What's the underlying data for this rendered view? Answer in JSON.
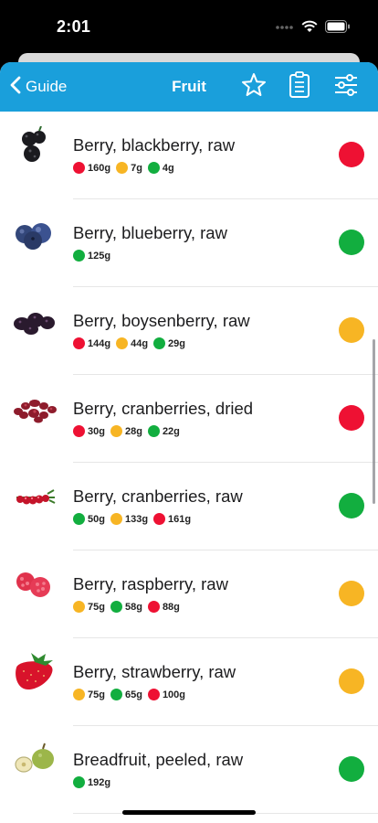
{
  "status_bar": {
    "time": "2:01"
  },
  "nav": {
    "back_label": "Guide",
    "title": "Fruit"
  },
  "colors": {
    "red": "#ee1133",
    "orange": "#f7b524",
    "green": "#12ae3f",
    "nav_blue": "#1a9fdb"
  },
  "foods": [
    {
      "name": "Berry, blackberry, raw",
      "status": "red",
      "icon": "blackberry-icon",
      "chips": [
        {
          "color": "red",
          "value": "160g"
        },
        {
          "color": "orange",
          "value": "7g"
        },
        {
          "color": "green",
          "value": "4g"
        }
      ]
    },
    {
      "name": "Berry, blueberry, raw",
      "status": "green",
      "icon": "blueberry-icon",
      "chips": [
        {
          "color": "green",
          "value": "125g"
        }
      ]
    },
    {
      "name": "Berry, boysenberry, raw",
      "status": "orange",
      "icon": "boysenberry-icon",
      "chips": [
        {
          "color": "red",
          "value": "144g"
        },
        {
          "color": "orange",
          "value": "44g"
        },
        {
          "color": "green",
          "value": "29g"
        }
      ]
    },
    {
      "name": "Berry, cranberries, dried",
      "status": "red",
      "icon": "dried-cranberries-icon",
      "chips": [
        {
          "color": "red",
          "value": "30g"
        },
        {
          "color": "orange",
          "value": "28g"
        },
        {
          "color": "green",
          "value": "22g"
        }
      ]
    },
    {
      "name": "Berry, cranberries, raw",
      "status": "green",
      "icon": "cranberries-icon",
      "chips": [
        {
          "color": "green",
          "value": "50g"
        },
        {
          "color": "orange",
          "value": "133g"
        },
        {
          "color": "red",
          "value": "161g"
        }
      ]
    },
    {
      "name": "Berry, raspberry, raw",
      "status": "orange",
      "icon": "raspberry-icon",
      "chips": [
        {
          "color": "orange",
          "value": "75g"
        },
        {
          "color": "green",
          "value": "58g"
        },
        {
          "color": "red",
          "value": "88g"
        }
      ]
    },
    {
      "name": "Berry, strawberry, raw",
      "status": "orange",
      "icon": "strawberry-icon",
      "chips": [
        {
          "color": "orange",
          "value": "75g"
        },
        {
          "color": "green",
          "value": "65g"
        },
        {
          "color": "red",
          "value": "100g"
        }
      ]
    },
    {
      "name": "Breadfruit, peeled, raw",
      "status": "green",
      "icon": "breadfruit-icon",
      "chips": [
        {
          "color": "green",
          "value": "192g"
        }
      ]
    }
  ]
}
